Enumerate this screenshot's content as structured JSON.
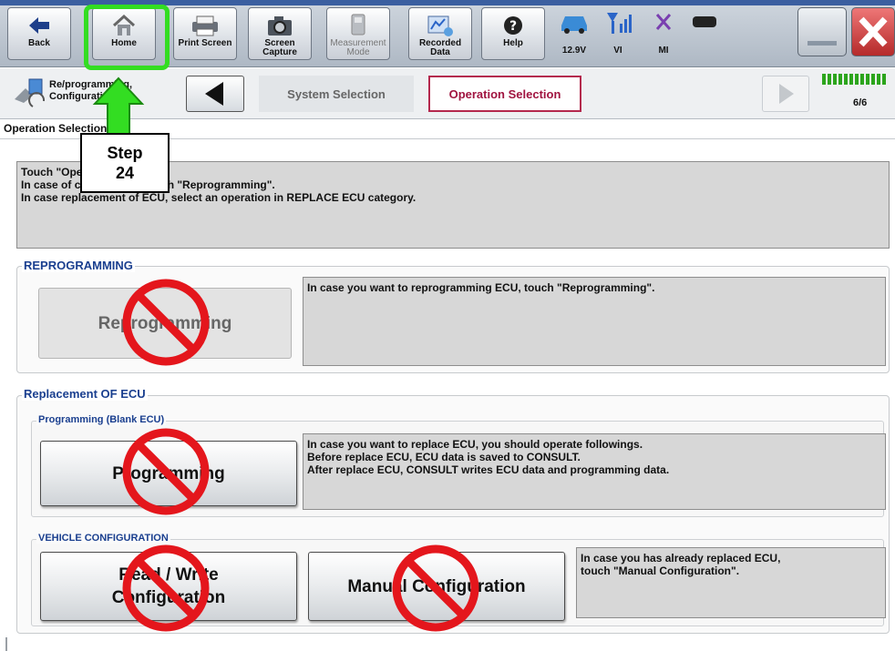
{
  "toolbar": {
    "back": "Back",
    "home": "Home",
    "print_screen": "Print Screen",
    "screen_capture": "Screen Capture",
    "measurement_mode": "Measurement Mode",
    "recorded_data": "Recorded Data",
    "help": "Help"
  },
  "status": {
    "battery": "12.9V",
    "vi": "VI",
    "mi": "MI"
  },
  "nav": {
    "app_label": "Re/programming, Configuration",
    "crumb_system": "System Selection",
    "crumb_operation": "Operation Selection",
    "page": "6/6"
  },
  "page": {
    "title": "Operation Selection",
    "instruction": [
      "Touch \"Operation\".",
      "In case of current ECU, touch \"Reprogramming\".",
      "In case replacement of ECU, select an operation in REPLACE ECU category."
    ]
  },
  "reprogramming": {
    "title": "REPROGRAMMING",
    "button": "Reprogramming",
    "description": "In case you want to reprogramming ECU, touch \"Reprogramming\"."
  },
  "replacement": {
    "title": "Replacement OF ECU",
    "programming": {
      "title": "Programming (Blank ECU)",
      "button": "Programming",
      "description": [
        "In case you want to replace ECU, you should operate followings.",
        "Before replace ECU, ECU data is saved to CONSULT.",
        "After replace ECU, CONSULT writes ECU data and programming data."
      ]
    },
    "vehicle_config": {
      "title": "VEHICLE CONFIGURATION",
      "read_write_line1": "Read / Write",
      "read_write_line2": "Configuration",
      "manual": "Manual Configuration",
      "description": [
        "In case you has already replaced ECU,",
        "touch \"Manual Configuration\"."
      ]
    }
  },
  "annotation": {
    "step_line1": "Step",
    "step_line2": "24",
    "highlight_color": "#33dd22",
    "prohibit_color": "#e4161c"
  }
}
